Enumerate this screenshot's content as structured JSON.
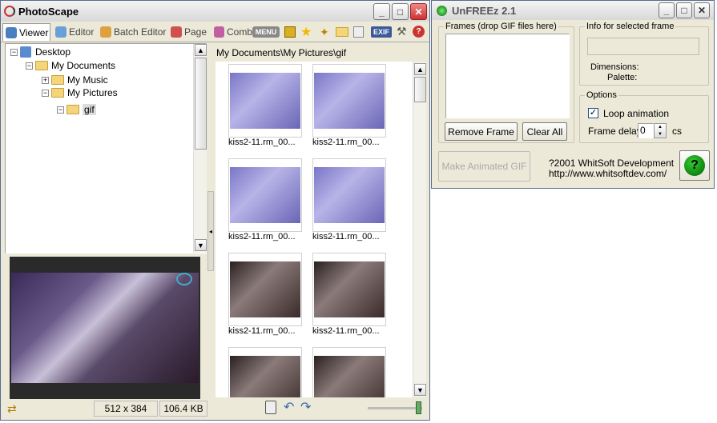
{
  "photoscape": {
    "title": "PhotoScape",
    "tabs": [
      {
        "label": "Viewer"
      },
      {
        "label": "Editor"
      },
      {
        "label": "Batch Editor"
      },
      {
        "label": "Page"
      },
      {
        "label": "Comb"
      }
    ],
    "menu_label": "MENU",
    "exif_label": "EXIF",
    "tree": {
      "desktop": "Desktop",
      "my_documents": "My Documents",
      "my_music": "My Music",
      "my_pictures": "My Pictures",
      "gif": "gif"
    },
    "path": "My Documents\\My Pictures\\gif",
    "thumb_caption": "kiss2-11.rm_00...",
    "status": {
      "dimensions": "512 x 384",
      "size": "106.4 KB"
    },
    "colors": {
      "accent": "#8a86d6",
      "window_bg": "#ece9d8"
    }
  },
  "unfreez": {
    "title": "UnFREEz 2.1",
    "frames_legend": "Frames (drop GIF files here)",
    "info_legend": "Info for selected frame",
    "dimensions_label": "Dimensions:",
    "palette_label": "Palette:",
    "remove_frame": "Remove Frame",
    "clear_all": "Clear All",
    "options_legend": "Options",
    "loop_label": "Loop animation",
    "loop_checked": true,
    "frame_delay_label": "Frame delay:",
    "frame_delay_value": "0",
    "cs_unit": "cs",
    "make_gif": "Make Animated GIF",
    "copyright": "?2001 WhitSoft Development",
    "website": "http://www.whitsoftdev.com/",
    "help_icon": "question-icon"
  }
}
